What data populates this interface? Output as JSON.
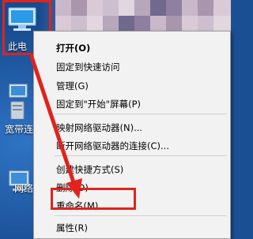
{
  "desktop": {
    "icons": [
      {
        "label": "此电",
        "icon": "computer-icon"
      },
      {
        "label": "宽带连",
        "icon": "network-icon"
      },
      {
        "label": "网络",
        "icon": "network-icon"
      }
    ]
  },
  "context_menu": {
    "items": [
      {
        "label": "打开(O)",
        "bold": true
      },
      {
        "label": "固定到快速访问"
      },
      {
        "label": "管理(G)"
      },
      {
        "label": "固定到\"开始\"屏幕(P)"
      },
      {
        "label": "映射网络驱动器(N)..."
      },
      {
        "label": "断开网络驱动器的连接(C)..."
      },
      {
        "label": "创建快捷方式(S)"
      },
      {
        "label": "删除(D)"
      },
      {
        "label": "重命名(M)"
      },
      {
        "label": "属性(R)"
      }
    ]
  },
  "colors": {
    "highlight": "#e0231d",
    "menu_bg": "#f2f2f2"
  }
}
